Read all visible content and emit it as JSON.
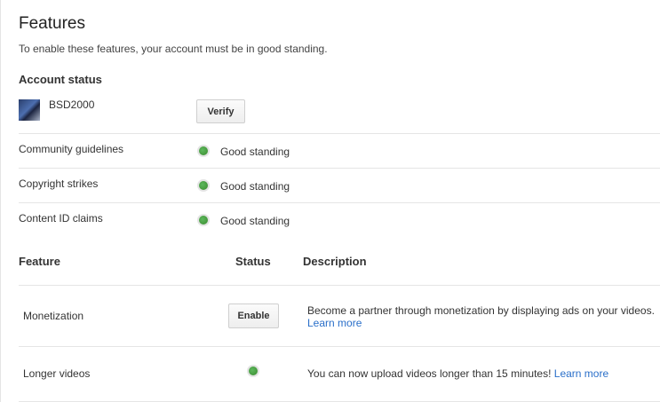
{
  "page": {
    "title": "Features",
    "intro": "To enable these features, your account must be in good standing."
  },
  "account": {
    "heading": "Account status",
    "name": "BSD2000",
    "verify_label": "Verify"
  },
  "status_rows": [
    {
      "label": "Community guidelines",
      "status": "Good standing",
      "status_color": "#3b8a2f"
    },
    {
      "label": "Copyright strikes",
      "status": "Good standing",
      "status_color": "#3b8a2f"
    },
    {
      "label": "Content ID claims",
      "status": "Good standing",
      "status_color": "#3b8a2f"
    }
  ],
  "features_table": {
    "headers": {
      "feature": "Feature",
      "status": "Status",
      "description": "Description"
    },
    "rows": [
      {
        "name": "Monetization",
        "enable_label": "Enable",
        "description": "Become a partner through monetization by displaying ads on your videos.",
        "link": "Learn more"
      },
      {
        "name": "Longer videos",
        "description": "You can now upload videos longer than 15 minutes!",
        "link": "Learn more"
      }
    ]
  },
  "colors": {
    "link": "#2a6fc9",
    "good_status": "#3b8a2f",
    "divider": "#e5e5e5"
  }
}
